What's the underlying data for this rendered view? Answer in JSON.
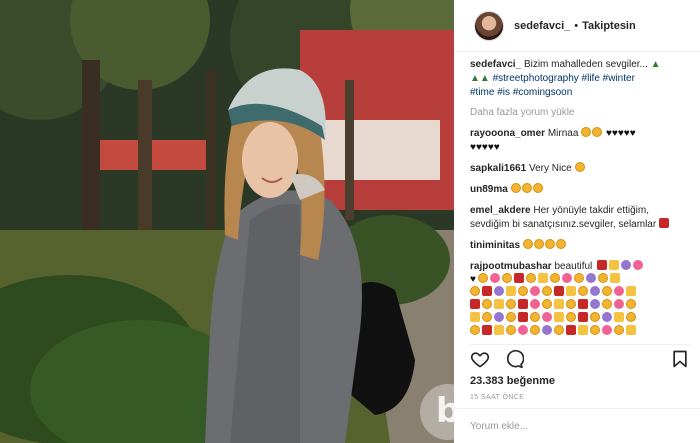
{
  "post": {
    "username": "sedefavci_",
    "separator": "•",
    "follow_status": "Takiptesin"
  },
  "caption": {
    "username": "sedefavci_",
    "text": "Bizim mahalleden sevgiler...",
    "hashtags": [
      "#streetphotography",
      "#life",
      "#winter",
      "#time",
      "#is",
      "#comingsoon"
    ]
  },
  "load_more": "Daha fazla yorum yükle",
  "comments": [
    {
      "username": "rayooona_omer",
      "text": "Mirnaa"
    },
    {
      "username": "sapkali1661",
      "text": "Very Nice"
    },
    {
      "username": "un89ma",
      "text": ""
    },
    {
      "username": "emel_akdere",
      "text": "Her yönüyle takdir ettiğim, sevdiğim bi sanatçısınız.sevgiler, selamlar"
    },
    {
      "username": "tiniminitas",
      "text": ""
    },
    {
      "username": "rajpootmubashar",
      "text": "beautiful"
    }
  ],
  "likes": "23.383 beğenme",
  "timestamp": "15 SAAT ÖNCE",
  "comment_placeholder": "Yorum ekle...",
  "watermark": "b",
  "icons": {
    "like": "heart-icon",
    "comment": "comment-icon",
    "save": "bookmark-icon"
  }
}
